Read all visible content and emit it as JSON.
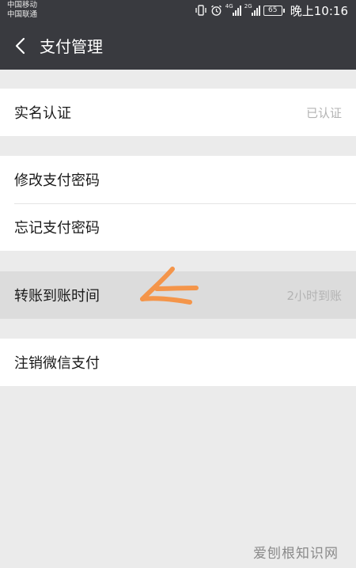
{
  "status_bar": {
    "carrier_1": "中国移动",
    "carrier_2": "中国联通",
    "net_1": "4G",
    "net_2": "2G",
    "battery": "65",
    "time": "晚上10:16"
  },
  "header": {
    "title": "支付管理"
  },
  "groups": [
    {
      "items": [
        {
          "label": "实名认证",
          "value": "已认证"
        }
      ]
    },
    {
      "items": [
        {
          "label": "修改支付密码"
        },
        {
          "label": "忘记支付密码"
        }
      ]
    },
    {
      "items": [
        {
          "label": "转账到账时间",
          "value": "2小时到账",
          "state": "pressed"
        }
      ]
    },
    {
      "items": [
        {
          "label": "注销微信支付"
        }
      ]
    }
  ],
  "colors": {
    "header_bg": "#393a3f",
    "page_bg": "#ebebeb",
    "annotation": "#f4954a"
  },
  "watermark": "爱刨根知识网"
}
